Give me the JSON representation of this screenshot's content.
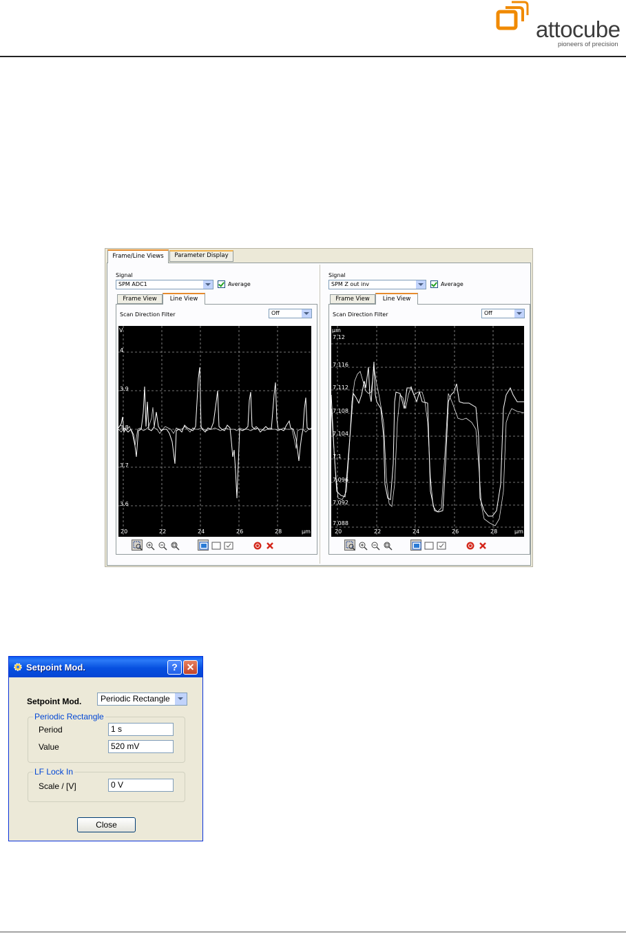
{
  "brand": {
    "name": "attocube",
    "tagline": "pioneers of precision"
  },
  "scan_window": {
    "tabs": [
      "Frame/Line Views",
      "Parameter Display"
    ],
    "left": {
      "signal_label": "Signal",
      "signal_value": "SPM ADC1",
      "average_label": "Average",
      "average_checked": true,
      "subtabs": [
        "Frame View",
        "Line View"
      ],
      "filter_label": "Scan Direction Filter",
      "filter_value": "Off",
      "unit": "V",
      "y_ticks": [
        "4",
        "3.9",
        "3.8",
        "3.7",
        "3.6"
      ],
      "x_ticks": [
        "20",
        "22",
        "24",
        "26",
        "28"
      ],
      "x_unit": "µm"
    },
    "right": {
      "signal_label": "Signal",
      "signal_value": "SPM Z out inv",
      "average_label": "Average",
      "average_checked": true,
      "subtabs": [
        "Frame View",
        "Line View"
      ],
      "filter_label": "Scan Direction Filter",
      "filter_value": "Off",
      "unit": "µm",
      "y_ticks": [
        "7.12",
        "7.116",
        "7.112",
        "7.108",
        "7.104",
        "7.1",
        "7.096",
        "7.092",
        "7.088"
      ],
      "x_ticks": [
        "20",
        "22",
        "24",
        "26",
        "28"
      ],
      "x_unit": "µm"
    },
    "toolbar_icons": [
      "select-zoom-icon",
      "zoom-in-icon",
      "zoom-out-icon",
      "zoom-fit-icon",
      "view-single-icon",
      "view-frame-icon",
      "view-check-icon",
      "export-icon",
      "clear-icon"
    ]
  },
  "dialog": {
    "title": "Setpoint Mod.",
    "help_glyph": "?",
    "close_glyph": "✕",
    "setpoint_label": "Setpoint Mod.",
    "setpoint_value": "Periodic Rectangle",
    "periodic_group": "Periodic Rectangle",
    "period_label": "Period",
    "period_value": "1 s",
    "value_label": "Value",
    "value_value": "520 mV",
    "lf_group": "LF Lock In",
    "scale_label": "Scale / [V]",
    "scale_value": "0 V",
    "close_label": "Close"
  },
  "colors": {
    "logo_orange": "#f08a00",
    "plot_bg": "#000000",
    "trace": "#ffffff",
    "grid": "#9a9a9a",
    "xp_title_blue": "#0a5bf2",
    "group_title": "#0046d5"
  }
}
